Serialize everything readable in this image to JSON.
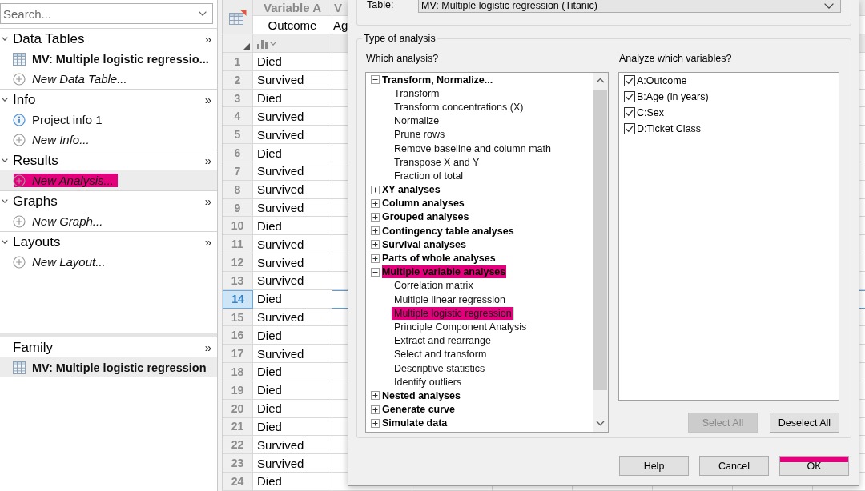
{
  "sidebar": {
    "search": {
      "placeholder": "Search..."
    },
    "sections": [
      {
        "title": "Data Tables",
        "expanded": true,
        "more": "»",
        "items": [
          {
            "kind": "table",
            "label": "MV: Multiple logistic regressio...",
            "selected": false,
            "highlighted": false
          },
          {
            "kind": "new",
            "label": "New Data Table...",
            "selected": false,
            "highlighted": false
          }
        ]
      },
      {
        "title": "Info",
        "expanded": true,
        "more": "»",
        "items": [
          {
            "kind": "info",
            "label": "Project info 1",
            "selected": false,
            "highlighted": false
          },
          {
            "kind": "new",
            "label": "New Info...",
            "selected": false,
            "highlighted": false
          }
        ]
      },
      {
        "title": "Results",
        "expanded": true,
        "more": "»",
        "items": [
          {
            "kind": "new",
            "label": "New Analysis...",
            "selected": true,
            "highlighted": true
          }
        ]
      },
      {
        "title": "Graphs",
        "expanded": true,
        "more": "»",
        "items": [
          {
            "kind": "new",
            "label": "New Graph...",
            "selected": false,
            "highlighted": false
          }
        ]
      },
      {
        "title": "Layouts",
        "expanded": true,
        "more": "»",
        "items": [
          {
            "kind": "new",
            "label": "New Layout...",
            "selected": false,
            "highlighted": false
          }
        ]
      }
    ]
  },
  "family": {
    "title": "Family",
    "more": "»",
    "items": [
      {
        "kind": "table",
        "label": "MV: Multiple logistic regression",
        "selected": true,
        "highlighted": false
      }
    ]
  },
  "data_table": {
    "columns": [
      {
        "title": "Variable A",
        "subtitle": "Outcome"
      },
      {
        "title": "V",
        "subtitle": "Ag"
      }
    ],
    "rows": [
      {
        "number": "1",
        "values": [
          "Died"
        ],
        "selected": false
      },
      {
        "number": "2",
        "values": [
          "Survived"
        ],
        "selected": false
      },
      {
        "number": "3",
        "values": [
          "Died"
        ],
        "selected": false
      },
      {
        "number": "4",
        "values": [
          "Survived"
        ],
        "selected": false
      },
      {
        "number": "5",
        "values": [
          "Survived"
        ],
        "selected": false
      },
      {
        "number": "6",
        "values": [
          "Died"
        ],
        "selected": false
      },
      {
        "number": "7",
        "values": [
          "Survived"
        ],
        "selected": false
      },
      {
        "number": "8",
        "values": [
          "Survived"
        ],
        "selected": false
      },
      {
        "number": "9",
        "values": [
          "Survived"
        ],
        "selected": false
      },
      {
        "number": "10",
        "values": [
          "Died"
        ],
        "selected": false
      },
      {
        "number": "11",
        "values": [
          "Survived"
        ],
        "selected": false
      },
      {
        "number": "12",
        "values": [
          "Survived"
        ],
        "selected": false
      },
      {
        "number": "13",
        "values": [
          "Survived"
        ],
        "selected": false
      },
      {
        "number": "14",
        "values": [
          "Died"
        ],
        "selected": true
      },
      {
        "number": "15",
        "values": [
          "Survived"
        ],
        "selected": false
      },
      {
        "number": "16",
        "values": [
          "Died"
        ],
        "selected": false
      },
      {
        "number": "17",
        "values": [
          "Survived"
        ],
        "selected": false
      },
      {
        "number": "18",
        "values": [
          "Died"
        ],
        "selected": false
      },
      {
        "number": "19",
        "values": [
          "Died"
        ],
        "selected": false
      },
      {
        "number": "20",
        "values": [
          "Died"
        ],
        "selected": false
      },
      {
        "number": "21",
        "values": [
          "Died"
        ],
        "selected": false
      },
      {
        "number": "22",
        "values": [
          "Survived"
        ],
        "selected": false
      },
      {
        "number": "23",
        "values": [
          "Survived"
        ],
        "selected": false
      },
      {
        "number": "24",
        "values": [
          "Died"
        ],
        "selected": false
      }
    ]
  },
  "dialog": {
    "table_label": "Table:",
    "table_choice": "MV: Multiple logistic regression (Titanic)",
    "group_title": "Type of analysis",
    "analysis_label": "Which analysis?",
    "analyses": [
      {
        "label": "Transform, Normalize...",
        "expanded": true,
        "selected": false,
        "highlighted": false,
        "children": [
          {
            "label": "Transform",
            "selected": false,
            "highlighted": false
          },
          {
            "label": "Transform concentrations (X)",
            "selected": false,
            "highlighted": false
          },
          {
            "label": "Normalize",
            "selected": false,
            "highlighted": false
          },
          {
            "label": "Prune rows",
            "selected": false,
            "highlighted": false
          },
          {
            "label": "Remove baseline and column math",
            "selected": false,
            "highlighted": false
          },
          {
            "label": "Transpose X and Y",
            "selected": false,
            "highlighted": false
          },
          {
            "label": "Fraction of total",
            "selected": false,
            "highlighted": false
          }
        ]
      },
      {
        "label": "XY analyses",
        "expanded": false,
        "selected": false,
        "highlighted": false
      },
      {
        "label": "Column analyses",
        "expanded": false,
        "selected": false,
        "highlighted": false
      },
      {
        "label": "Grouped analyses",
        "expanded": false,
        "selected": false,
        "highlighted": false
      },
      {
        "label": "Contingency table analyses",
        "expanded": false,
        "selected": false,
        "highlighted": false
      },
      {
        "label": "Survival analyses",
        "expanded": false,
        "selected": false,
        "highlighted": false
      },
      {
        "label": "Parts of whole analyses",
        "expanded": false,
        "selected": false,
        "highlighted": false
      },
      {
        "label": "Multiple variable analyses",
        "expanded": true,
        "selected": false,
        "highlighted": true,
        "children": [
          {
            "label": "Correlation matrix",
            "selected": false,
            "highlighted": false
          },
          {
            "label": "Multiple linear regression",
            "selected": false,
            "highlighted": false
          },
          {
            "label": "Multiple logistic regression",
            "selected": true,
            "highlighted": true
          },
          {
            "label": "Principle Component Analysis",
            "selected": false,
            "highlighted": false
          },
          {
            "label": "Extract and rearrange",
            "selected": false,
            "highlighted": false
          },
          {
            "label": "Select and transform",
            "selected": false,
            "highlighted": false
          },
          {
            "label": "Descriptive statistics",
            "selected": false,
            "highlighted": false
          },
          {
            "label": "Identify outliers",
            "selected": false,
            "highlighted": false
          }
        ]
      },
      {
        "label": "Nested analyses",
        "expanded": false,
        "selected": false,
        "highlighted": false
      },
      {
        "label": "Generate curve",
        "expanded": false,
        "selected": false,
        "highlighted": false
      },
      {
        "label": "Simulate data",
        "expanded": false,
        "selected": false,
        "highlighted": false
      }
    ],
    "variables_label": "Analyze which variables?",
    "variables": [
      {
        "label": "A:Outcome",
        "checked": true
      },
      {
        "label": "B:Age (in years)",
        "checked": true
      },
      {
        "label": "C:Sex",
        "checked": true
      },
      {
        "label": "D:Ticket Class",
        "checked": true
      }
    ],
    "list_buttons": [
      {
        "label": "Select All",
        "disabled": true
      },
      {
        "label": "Deselect All",
        "disabled": false
      }
    ],
    "buttons": [
      {
        "label": "Help",
        "highlighted": false
      },
      {
        "label": "Cancel",
        "highlighted": false
      },
      {
        "label": "OK",
        "highlighted": true
      }
    ]
  }
}
